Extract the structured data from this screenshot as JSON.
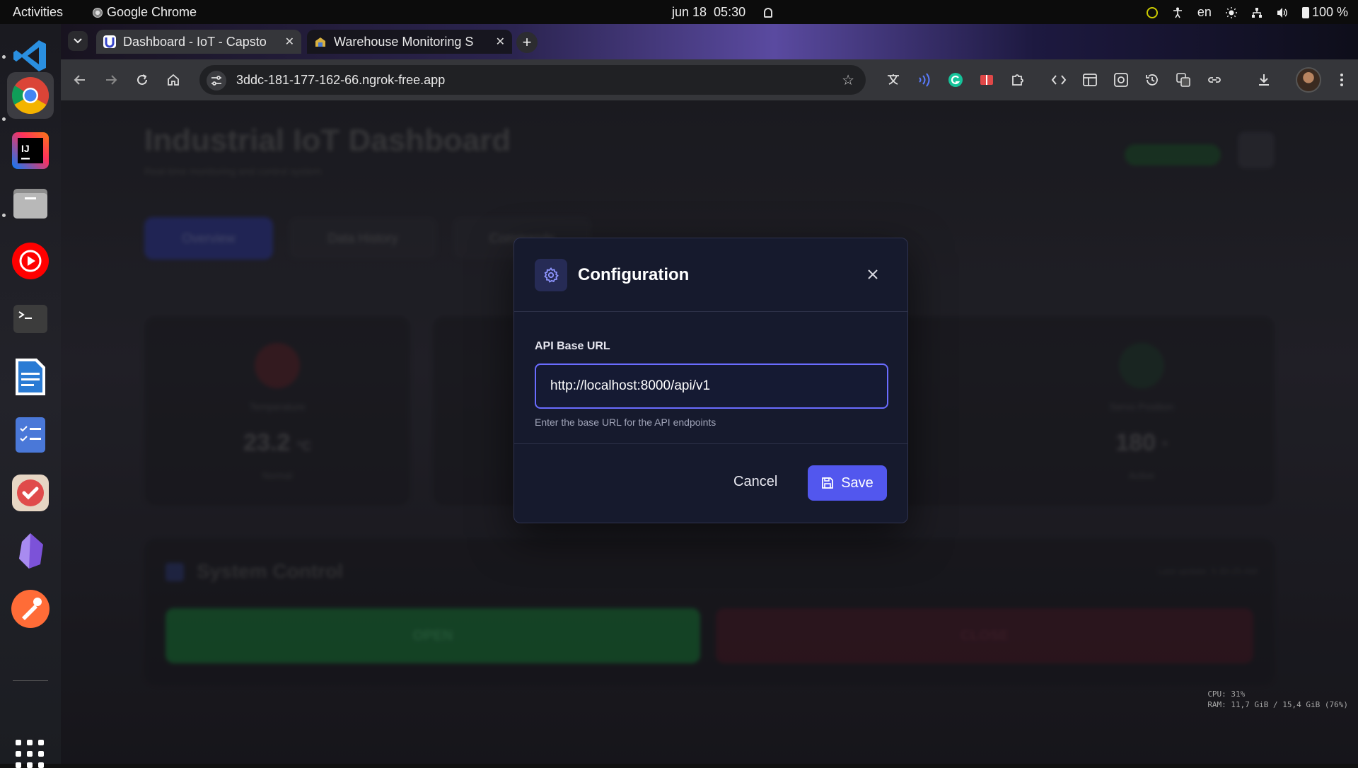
{
  "os": {
    "activities": "Activities",
    "app_name": "Google Chrome",
    "date": "jun 18",
    "time": "05:30",
    "lang": "en",
    "battery": "100 %"
  },
  "dock": {
    "items": [
      "vscode",
      "chrome",
      "intellij",
      "files",
      "youtube-music",
      "terminal",
      "document-viewer",
      "tasks",
      "todo",
      "obsidian",
      "postman"
    ]
  },
  "browser": {
    "tabs": [
      {
        "title": "Dashboard - IoT - Capsto",
        "active": true
      },
      {
        "title": "Warehouse Monitoring S",
        "active": false
      }
    ],
    "url": "3ddc-181-177-162-66.ngrok-free.app"
  },
  "dashboard": {
    "title": "Industrial IoT Dashboard",
    "subtitle": "Real-time monitoring and control system",
    "tabs": [
      "Overview",
      "Data History",
      "Commands"
    ],
    "cards": [
      {
        "label": "Temperature",
        "value": "23.2",
        "unit": "°C",
        "sub": "Normal",
        "color": "#5a1e24"
      },
      {
        "label": "",
        "value": "",
        "unit": "",
        "sub": "",
        "color": "#2a2a30"
      },
      {
        "label": "",
        "value": "",
        "unit": "",
        "sub": "",
        "color": "#2a2a30"
      },
      {
        "label": "Servo Position",
        "value": "180",
        "unit": "°",
        "sub": "Active",
        "color": "#1c3a28"
      }
    ],
    "control": {
      "title": "System Control",
      "last_update": "Last update: 5:30:25 AM",
      "open_label": "OPEN",
      "close_label": "CLOSE"
    }
  },
  "modal": {
    "title": "Configuration",
    "field_label": "API Base URL",
    "field_value": "http://localhost:8000/api/v1",
    "help_text": "Enter the base URL for the API endpoints",
    "cancel_label": "Cancel",
    "save_label": "Save",
    "accent": "#5257ee"
  },
  "sysmon": {
    "cpu": "CPU: 31%",
    "ram": "RAM: 11,7 GiB / 15,4 GiB (76%)"
  }
}
